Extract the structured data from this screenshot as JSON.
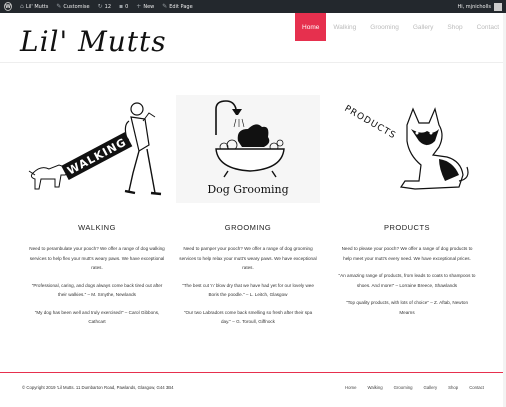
{
  "adminbar": {
    "site_name": "Lil' Mutts",
    "customise": "Customise",
    "comments_count": "12",
    "updates_count": "0",
    "new_label": "New",
    "edit_page": "Edit Page",
    "user_greeting": "Hi, mjnicholls"
  },
  "header": {
    "logo": "Lil' Mutts",
    "nav": [
      "Home",
      "Walking",
      "Grooming",
      "Gallery",
      "Shop",
      "Contact"
    ]
  },
  "columns": [
    {
      "title": "WALKING",
      "image_text": "WALKING",
      "paragraphs": [
        "Need to perambulate your pooch? We offer a range of dog walking services to help flex your mutt's weary paws. We have exceptional rates.",
        "\"Professional, caring, and dogs always come back tired out after their walkies.\" – M. Smythe, Newlands",
        "\"My dog has been well and truly exercised!\" – Carol Gibbons, Cathcart"
      ]
    },
    {
      "title": "GROOMING",
      "image_text": "Dog Grooming",
      "paragraphs": [
        "Need to pamper your pooch? We offer a range of dog grooming services to help relax your mutt's weary paws. We have exceptional rates.",
        "\"The best cut 'n' blow dry that we have had yet for our lovely wee Boris the poodle.\" – L. Leitch, Glasgow",
        "\"Our two Labradors come back smelling so fresh after their spa day.\" – G. Toroull, Giffnock"
      ]
    },
    {
      "title": "PRODUCTS",
      "image_text": "PRODUCTS",
      "paragraphs": [
        "Need to please your pooch? We offer a range of dog products to help meet your mutt's every need. We have exceptional prices.",
        "\"An amazing range of products, from leads to coats to shampoos to shoes. And more!\" – Lorraine Breece, Shawlands",
        "\"Top quality products, with lots of choice\" – Z. Aftab, Newton Mearns"
      ]
    }
  ],
  "footer": {
    "copyright": "© Copyright 2019 'Lil Mutts. 11 Dumbarton Road, Pawlands, Glasgow, G44 3B4",
    "nav": [
      "Home",
      "Walking",
      "Grooming",
      "Gallery",
      "Shop",
      "Contact"
    ]
  },
  "colors": {
    "accent": "#e6304e",
    "adminbar": "#23282d"
  }
}
